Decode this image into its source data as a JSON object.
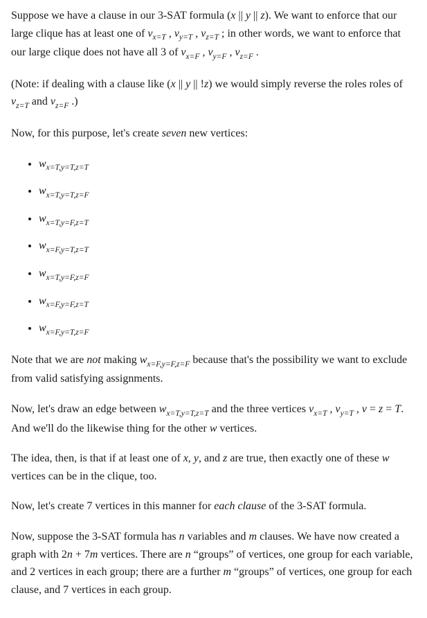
{
  "p1a": "Suppose we have a clause in our 3-SAT formula (",
  "p1b": " || ",
  "p1c": " || ",
  "p1d": "). We want to enforce that our large clique has at least one of ",
  "p1e": " , ",
  "p1f": " , ",
  "p1g": " ; in other words, we want to enforce that our large clique does not have all 3 of ",
  "p1h": " , ",
  "p1i": " , ",
  "p1j": " .",
  "x": "x",
  "y": "y",
  "z": "z",
  "v": "v",
  "w": "w",
  "n": "n",
  "m": "m",
  "sub_xT": "x=T",
  "sub_yT": "y=T",
  "sub_zT": "z=T",
  "sub_xF": "x=F",
  "sub_yF": "y=F",
  "sub_zF": "z=F",
  "p2a": "(Note: if dealing with a clause like (",
  "p2b": " || ",
  "p2c": " || !",
  "p2d": ") we would simply reverse the roles roles of ",
  "p2e": " and ",
  "p2f": " .)",
  "p3a": "Now, for this purpose, let's create ",
  "p3b": "seven",
  "p3c": " new vertices:",
  "li1": "x=T,y=T,z=T",
  "li2": "x=T,y=T,z=F",
  "li3": "x=T,y=F,z=T",
  "li4": "x=F,y=T,z=T",
  "li5": "x=T,y=F,z=F",
  "li6": "x=F,y=F,z=T",
  "li7": "x=F,y=T,z=F",
  "p4a": "Note that we are ",
  "p4b": "not",
  "p4c": " making ",
  "p4d": " because that's the possibility we want to exclude from valid satisfying assignments.",
  "sub_FFF": "x=F,y=F,z=F",
  "p5a": "Now, let's draw an edge between ",
  "p5b": " and the three vertices ",
  "p5c": " , ",
  "p5d": " , ",
  "p5e": " = ",
  "p5f": " = ",
  "p5g": ". And we'll do the likewise thing for the other ",
  "p5h": " vertices.",
  "T": "T",
  "sub_TTT": "x=T,y=T,z=T",
  "p6a": "The idea, then, is that if at least one of ",
  "p6b": ", ",
  "p6c": ", and ",
  "p6d": " are true, then exactly one of these ",
  "p6e": " vertices can be in the clique, too.",
  "p7a": "Now, let's create 7 vertices in this manner for ",
  "p7b": "each clause",
  "p7c": " of the 3-SAT formula.",
  "p8a": "Now, suppose the 3-SAT formula has ",
  "p8b": " variables and ",
  "p8c": " clauses. We have now created a graph with 2",
  "p8d": " + 7",
  "p8e": " vertices. There are ",
  "p8f": " “groups” of vertices, one group for each variable, and 2 vertices in each group; there are a further ",
  "p8g": " “groups” of vertices, one group for each clause, and 7 vertices in each group."
}
